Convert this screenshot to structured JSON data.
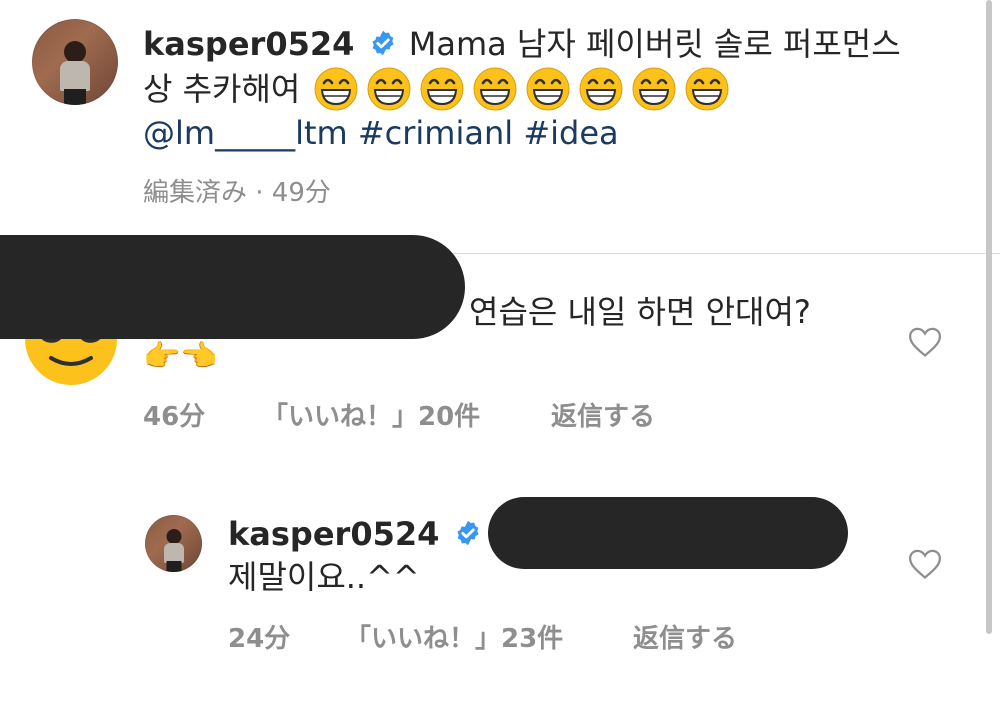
{
  "post": {
    "username": "kasper0524",
    "caption_line1": "Mama 남자 페이버릿 솔로 퍼포먼스",
    "caption_line2": "상 추카해여",
    "emoji_count": 8,
    "mention": "@lm_____ltm",
    "hashtag1": "#crimianl",
    "hashtag2": "#idea",
    "meta": "編集済み · 49分"
  },
  "comment": {
    "text_line1": "연습은 내일 하면 안대여?",
    "text_line2": "👉👈",
    "time": "46分",
    "likes": "「いいね！」20件",
    "reply": "返信する"
  },
  "reply": {
    "username": "kasper0524",
    "text": "제말이요..^^",
    "time": "24分",
    "likes": "「いいね！」23件",
    "reply": "返信する"
  },
  "icons": {
    "verified": "verified-badge-icon",
    "like": "heart-outline-icon",
    "commenter_avatar": "sunglasses-emoji-icon"
  },
  "colors": {
    "tag": "#1b3a60",
    "meta": "#8e8e8e",
    "verified": "#3897f0"
  }
}
